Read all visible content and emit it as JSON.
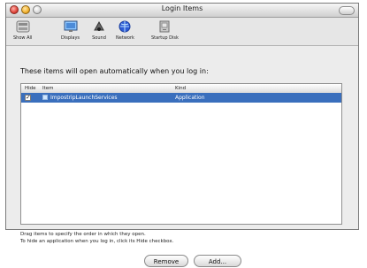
{
  "window": {
    "title": "Login Items"
  },
  "toolbar": {
    "items": [
      {
        "label": "Show All"
      },
      {
        "label": "Displays"
      },
      {
        "label": "Sound"
      },
      {
        "label": "Network"
      },
      {
        "label": "Startup Disk"
      }
    ]
  },
  "main": {
    "heading": "These items will open automatically when you log in:",
    "list": {
      "columns": [
        "Hide",
        "Item",
        "Kind"
      ],
      "rows": [
        {
          "hide_checked": true,
          "item": "ImpostripLaunchServices",
          "kind": "Application"
        }
      ]
    },
    "footer": {
      "line1": "Drag items to specify the order in which they open.",
      "line2": "To hide an application when you log in, click its Hide checkbox."
    },
    "buttons": {
      "remove": "Remove",
      "add": "Add..."
    }
  },
  "colors": {
    "selection": "#3a6fbd",
    "window_bg": "#ececec"
  },
  "icons": [
    "close-icon",
    "minimize-icon",
    "zoom-icon",
    "show-all-icon",
    "displays-icon",
    "sound-icon",
    "network-icon",
    "startup-disk-icon",
    "checkmark-icon",
    "application-icon"
  ]
}
